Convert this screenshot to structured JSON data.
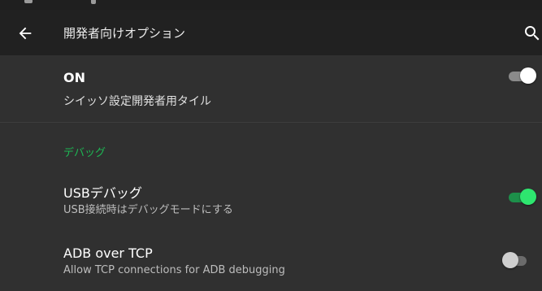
{
  "toolbar": {
    "title": "開発者向けオプション",
    "back_icon": "arrow-back-icon",
    "search_icon": "search-icon"
  },
  "master_switch": {
    "label": "ON",
    "subtitle": "シイッソ設定開発者用タイル",
    "state": "on"
  },
  "debug_section": {
    "header": "デバッグ",
    "accent_color": "#1db954"
  },
  "settings": [
    {
      "title": "USBデバッグ",
      "summary": "USB接続時はデバッグモードにする",
      "state": "on"
    },
    {
      "title": "ADB over TCP",
      "summary": "Allow TCP connections for ADB debugging",
      "state": "off"
    }
  ]
}
